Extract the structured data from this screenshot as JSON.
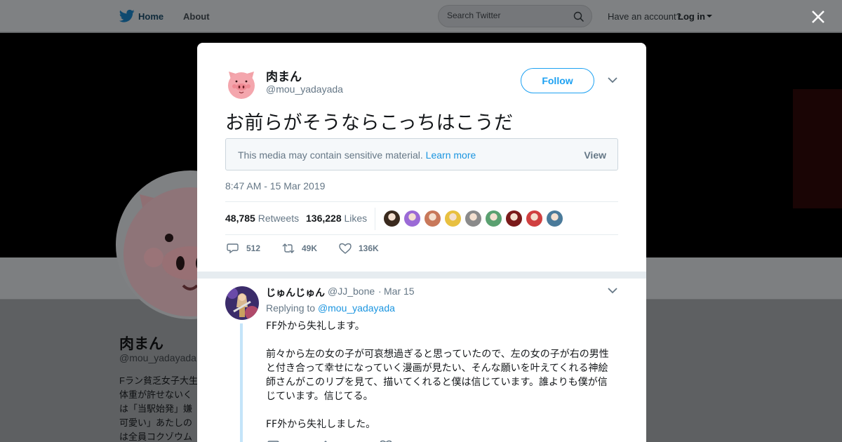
{
  "topnav": {
    "home_label": "Home",
    "about_label": "About",
    "search_placeholder": "Search Twitter",
    "account_text": "Have an account?",
    "login_label": "Log in"
  },
  "profile_bg": {
    "name": "肉まん",
    "handle": "@mou_yadayada",
    "bio_lines": [
      "Fラン貧乏女子大生",
      "体重が許せないく",
      "は「当駅始発」嫌",
      "可愛い」あたしの",
      "は全員コクゾウム"
    ]
  },
  "tweet": {
    "author_name": "肉まん",
    "author_handle": "@mou_yadayada",
    "follow_label": "Follow",
    "text": "お前らがそうならこっちはこうだ",
    "sensitive_message": "This media may contain sensitive material.",
    "learn_more_label": "Learn more",
    "view_label": "View",
    "timestamp": "8:47 AM - 15 Mar 2019",
    "retweets_count": "48,785",
    "retweets_label": "Retweets",
    "likes_count": "136,228",
    "likes_label": "Likes",
    "liker_colors": [
      "#3a2a1e",
      "#9b6ad6",
      "#c8785a",
      "#e8c040",
      "#8a8a8a",
      "#5aa070",
      "#7a1a1a",
      "#d04040",
      "#4a7a9a"
    ],
    "reply_count": "512",
    "retweet_action_count": "49K",
    "like_action_count": "136K"
  },
  "reply": {
    "author_name": "じゅんじゅん",
    "author_handle": "@JJ_bone",
    "separator": "·",
    "date": "Mar 15",
    "replying_to_label": "Replying to",
    "replying_to_handle": "@mou_yadayada",
    "paragraphs": [
      "FF外から失礼します。",
      "前々から左の女の子が可哀想過ぎると思っていたので、左の女の子が右の男性と付き合って幸せになっていく漫画が見たい、そんな願いを叶えてくれる神絵師さんがこのリプを見て、描いてくれると僕は信じています。誰よりも僕が信じています。信じてる。",
      "FF外から失礼しました。"
    ]
  },
  "colors": {
    "accent": "#1da1f2",
    "link": "#1b95e0",
    "muted_text": "#657786",
    "overlay_bg": "#5c5e60"
  }
}
